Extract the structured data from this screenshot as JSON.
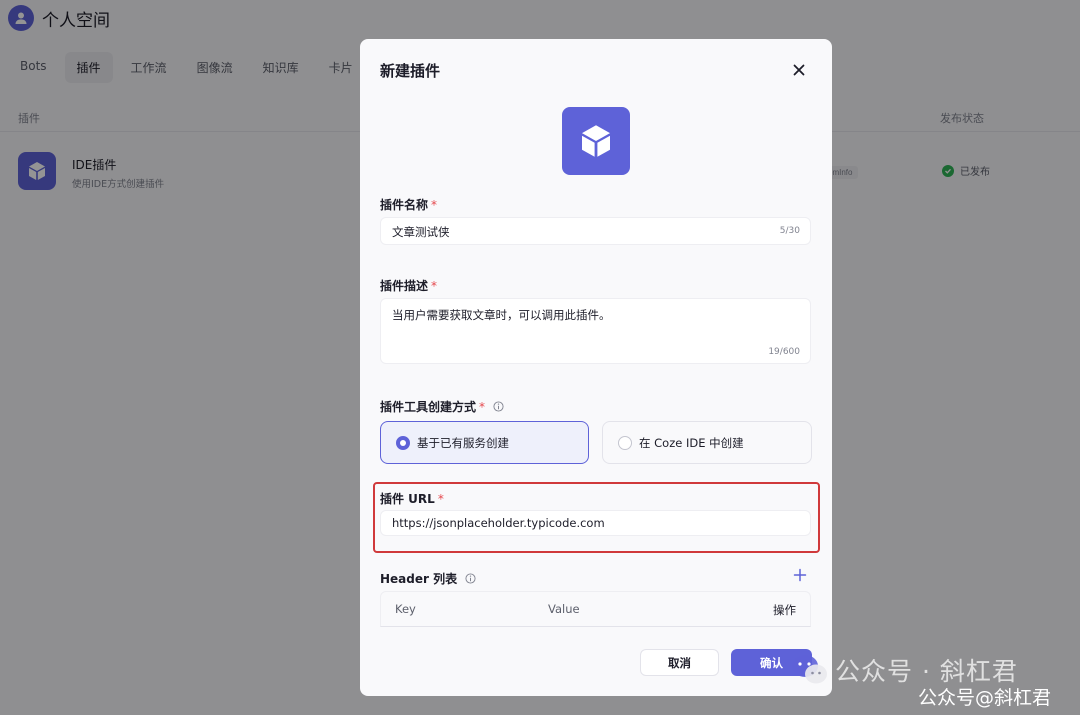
{
  "workspace": {
    "title": "个人空间"
  },
  "nav_tabs": [
    "Bots",
    "插件",
    "工作流",
    "图像流",
    "知识库",
    "卡片"
  ],
  "table": {
    "col_plugin": "插件",
    "col_status": "发布状态",
    "rows": [
      {
        "name": "IDE插件",
        "desc": "使用IDE方式创建插件",
        "tag": "omInfo",
        "status": "已发布"
      }
    ]
  },
  "modal": {
    "title": "新建插件",
    "close_icon": "close-icon",
    "name_field": {
      "label": "插件名称",
      "value": "文章测试侠",
      "counter": "5/30"
    },
    "desc_field": {
      "label": "插件描述",
      "value": "当用户需要获取文章时，可以调用此插件。",
      "counter": "19/600"
    },
    "create_mode": {
      "label": "插件工具创建方式",
      "options": [
        {
          "label": "基于已有服务创建",
          "selected": true
        },
        {
          "label": "在 Coze IDE 中创建",
          "selected": false
        }
      ]
    },
    "url_field": {
      "label": "插件 URL",
      "value": "https://jsonplaceholder.typicode.com"
    },
    "header_list": {
      "label": "Header 列表",
      "columns": {
        "key": "Key",
        "value": "Value",
        "action": "操作"
      }
    },
    "buttons": {
      "cancel": "取消",
      "confirm": "确认"
    },
    "required_mark": "*"
  },
  "watermark": {
    "line1": "公众号 · 斜杠君",
    "line2": "公众号@斜杠君"
  },
  "colors": {
    "accent": "#5e62d8",
    "highlight": "#d0393b",
    "success": "#2fb457",
    "required": "#e5484d"
  }
}
